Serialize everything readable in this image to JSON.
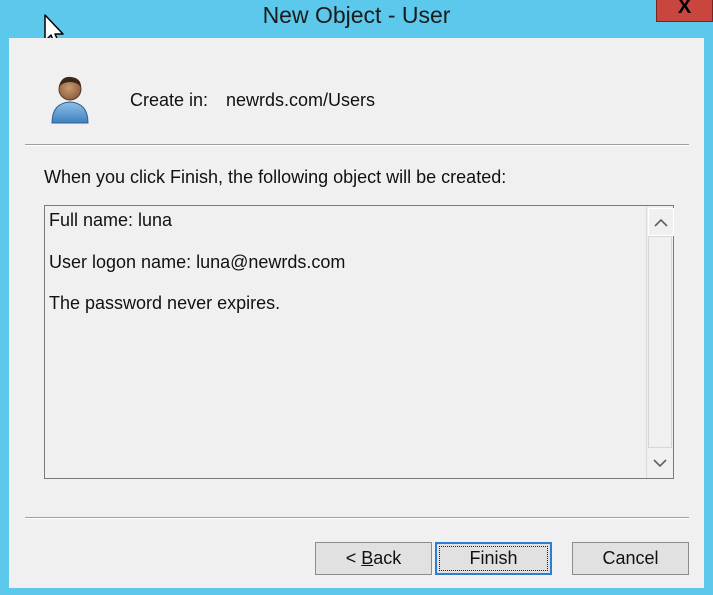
{
  "window": {
    "title": "New Object - User",
    "close_glyph": "X",
    "icon": "user-icon"
  },
  "header": {
    "create_in_label": "Create in:",
    "create_in_path": "newrds.com/Users"
  },
  "main": {
    "intro": "When you click Finish, the following object will be created:",
    "summary_lines": [
      "Full name: luna",
      "User logon name: luna@newrds.com",
      "The password never expires."
    ]
  },
  "buttons": {
    "back_prefix": "< ",
    "back_hotkey": "B",
    "back_rest": "ack",
    "finish": "Finish",
    "cancel": "Cancel"
  },
  "colors": {
    "title_bar": "#5cc8ec",
    "close_button": "#c8463e",
    "dialog_background": "#f0f0f0",
    "default_button_border": "#2b7fd0"
  }
}
